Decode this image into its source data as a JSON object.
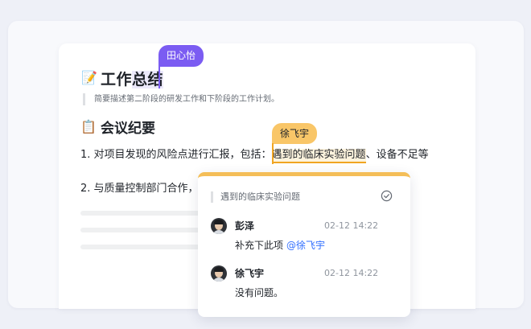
{
  "document": {
    "title_emoji": "📝",
    "title_plain": "工作",
    "title_highlight": "总结",
    "quote": "简要描述第二阶段的研发工作和下阶段的工作计划。",
    "section_emoji": "📋",
    "section_heading": "会议纪要",
    "item1_prefix": "1. 对项目发现的风险点进行汇报，包括：",
    "item1_selected": "遇到的临床实验问题",
    "item1_suffix": "、设备不足等",
    "item2": "2. 与质量控制部门合作，"
  },
  "collaborators": {
    "purple_user": "田心怡",
    "yellow_user": "徐飞宇"
  },
  "comment_panel": {
    "quote": "遇到的临床实验问题",
    "comments": [
      {
        "author": "彭泽",
        "time": "02-12 14:22",
        "text": "补充下此项",
        "mention": "@徐飞宇"
      },
      {
        "author": "徐飞宇",
        "time": "02-12 14:22",
        "text": "没有问题。",
        "mention": ""
      }
    ]
  },
  "colors": {
    "purple": "#7b5cf2",
    "yellow": "#f9c668",
    "accent_orange": "#f0a522",
    "mention": "#3370ff"
  }
}
